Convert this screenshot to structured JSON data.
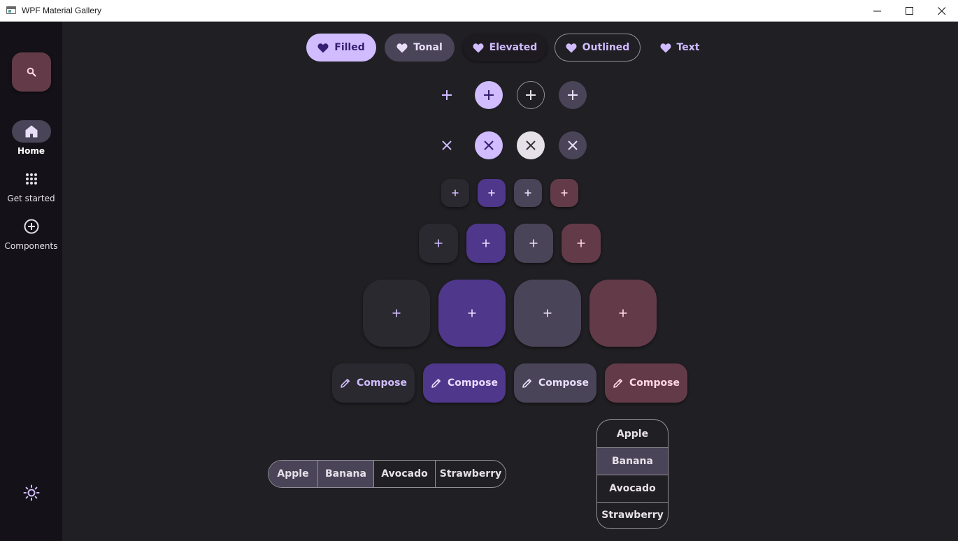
{
  "window": {
    "title": "WPF Material Gallery"
  },
  "nav_rail": {
    "items": [
      {
        "label": "Home",
        "icon": "home-icon",
        "active": true
      },
      {
        "label": "Get started",
        "icon": "apps-grid-icon",
        "active": false
      },
      {
        "label": "Components",
        "icon": "add-circle-icon",
        "active": false
      }
    ],
    "fab_icon": "search-icon",
    "theme_icon": "sun-icon"
  },
  "buttons": {
    "filled": "Filled",
    "tonal": "Tonal",
    "elevated": "Elevated",
    "outlined": "Outlined",
    "text": "Text",
    "icon": "heart-icon"
  },
  "icon_buttons": {
    "row1_icon": "plus-icon",
    "row2_icon": "close-icon",
    "variants": [
      "standard",
      "filled",
      "outlined",
      "tonal"
    ]
  },
  "fabs": {
    "icon": "plus-icon",
    "colors": [
      "surface",
      "primary",
      "secondary",
      "tertiary"
    ],
    "sizes": [
      "small",
      "medium",
      "large"
    ]
  },
  "extended_fabs": {
    "label": "Compose",
    "icon": "pencil-icon"
  },
  "segmented_horizontal": {
    "options": [
      "Apple",
      "Banana",
      "Avocado",
      "Strawberry"
    ],
    "selected": [
      "Apple",
      "Banana"
    ]
  },
  "segmented_vertical": {
    "options": [
      "Apple",
      "Banana",
      "Avocado",
      "Strawberry"
    ],
    "selected": [
      "Banana"
    ]
  },
  "colors": {
    "primary": "#d0bcff",
    "on_primary": "#381e72",
    "primary_container": "#4f378b",
    "secondary_container": "#4a4458",
    "tertiary_container": "#633b48",
    "surface": "#201f23",
    "outline": "#938f99"
  }
}
